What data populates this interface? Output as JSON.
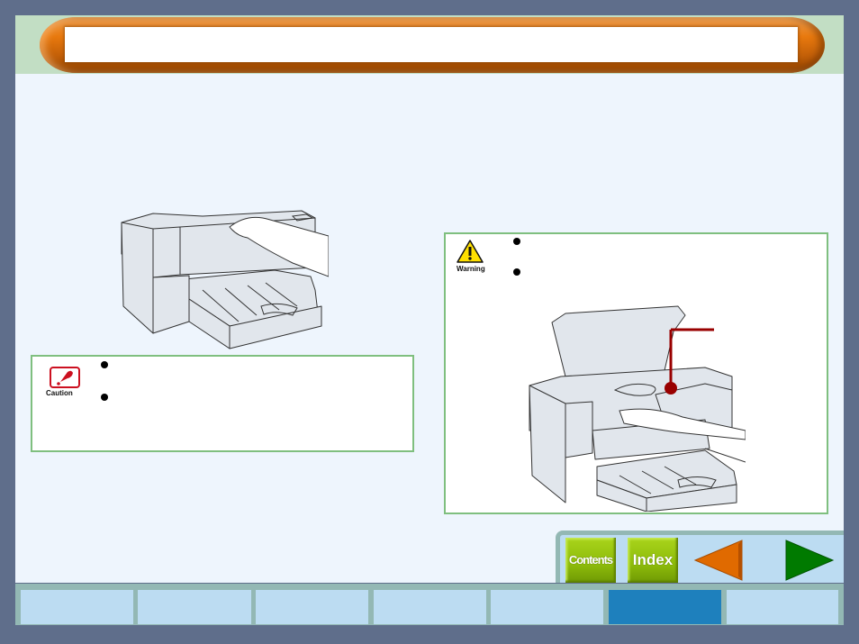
{
  "header": {
    "title": ""
  },
  "body": {
    "intro_text": ""
  },
  "illustrations": {
    "printer_closed": "printer-cleaning-top-cover-illustration",
    "printer_open": "printer-open-cover-cartridge-illustration",
    "callout_color": "#990000"
  },
  "caution": {
    "icon": "caution-icon",
    "label": "Caution",
    "bullets": [
      "",
      ""
    ]
  },
  "warning": {
    "icon": "warning-triangle-icon",
    "label": "Warning",
    "bullets": [
      "",
      ""
    ]
  },
  "nav": {
    "contents_label": "Contents",
    "index_label": "Index",
    "prev_icon": "arrow-left-icon",
    "next_icon": "arrow-right-icon",
    "prev_color": "#e06a00",
    "next_color": "#007a00"
  },
  "tabs": [
    {
      "label": "",
      "active": false
    },
    {
      "label": "",
      "active": false
    },
    {
      "label": "",
      "active": false
    },
    {
      "label": "",
      "active": false
    },
    {
      "label": "",
      "active": false
    },
    {
      "label": "",
      "active": true
    },
    {
      "label": "",
      "active": false
    }
  ]
}
